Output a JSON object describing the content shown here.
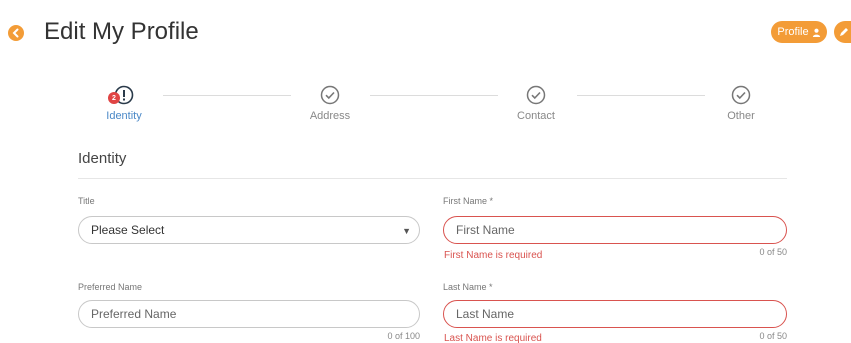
{
  "header": {
    "title": "Edit My Profile",
    "profile_label": "Profile"
  },
  "colors": {
    "accent": "#f39c37",
    "active_step": "#4a88c7",
    "error": "#d9534f"
  },
  "stepper": {
    "steps": [
      {
        "label": "Identity",
        "state": "error",
        "icon": "exclamation-circle-icon",
        "badge": "2"
      },
      {
        "label": "Address",
        "state": "complete",
        "icon": "check-circle-icon"
      },
      {
        "label": "Contact",
        "state": "complete",
        "icon": "check-circle-icon"
      },
      {
        "label": "Other",
        "state": "complete",
        "icon": "check-circle-icon"
      }
    ]
  },
  "section": {
    "title": "Identity"
  },
  "fields": {
    "title": {
      "label": "Title",
      "value": "Please Select"
    },
    "first_name": {
      "label": "First Name *",
      "placeholder": "First Name",
      "error": "First Name is required",
      "counter": "0 of 50"
    },
    "preferred_name": {
      "label": "Preferred Name",
      "placeholder": "Preferred Name",
      "counter": "0 of 100"
    },
    "last_name": {
      "label": "Last Name *",
      "placeholder": "Last Name",
      "error": "Last Name is required",
      "counter": "0 of 50"
    }
  }
}
